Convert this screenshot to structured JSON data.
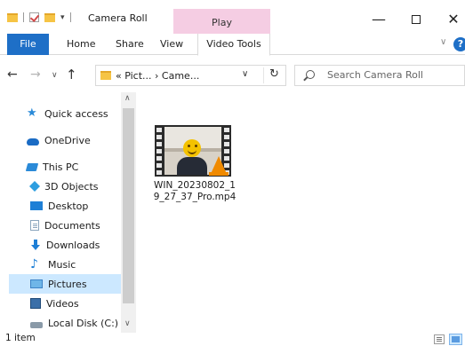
{
  "window": {
    "title": "Camera Roll",
    "contextual_tab_group": "Play",
    "minimize_glyph": "—",
    "close_glyph": "✕"
  },
  "ribbon": {
    "file_tab": "File",
    "tabs": [
      "Home",
      "Share",
      "View",
      "Video Tools"
    ],
    "collapse_glyph": "∨",
    "help_glyph": "?"
  },
  "nav": {
    "back_glyph": "←",
    "forward_glyph": "→",
    "recent_glyph": "∨",
    "up_glyph": "↑",
    "address_path": "« Pict... › Came...",
    "address_drop_glyph": "∨",
    "refresh_glyph": "↻",
    "search_placeholder": "Search Camera Roll"
  },
  "navpane": {
    "items": [
      {
        "label": "Quick access",
        "icon": "star-icon"
      },
      {
        "label": "OneDrive",
        "icon": "cloud-icon"
      },
      {
        "label": "This PC",
        "icon": "computer-icon"
      },
      {
        "label": "3D Objects",
        "icon": "cube-icon"
      },
      {
        "label": "Desktop",
        "icon": "desktop-icon"
      },
      {
        "label": "Documents",
        "icon": "document-icon"
      },
      {
        "label": "Downloads",
        "icon": "download-arrow-icon"
      },
      {
        "label": "Music",
        "icon": "music-note-icon"
      },
      {
        "label": "Pictures",
        "icon": "pictures-icon",
        "selected": true
      },
      {
        "label": "Videos",
        "icon": "video-icon"
      },
      {
        "label": "Local Disk (C:)",
        "icon": "drive-icon"
      }
    ],
    "scroll_up_glyph": "∧",
    "scroll_down_glyph": "∨"
  },
  "content": {
    "files": [
      {
        "name": "WIN_20230802_19_27_37_Pro.mp4",
        "type": "video",
        "thumbnail_icon": "vlc-icon"
      }
    ]
  },
  "status": {
    "item_count": "1 item"
  }
}
